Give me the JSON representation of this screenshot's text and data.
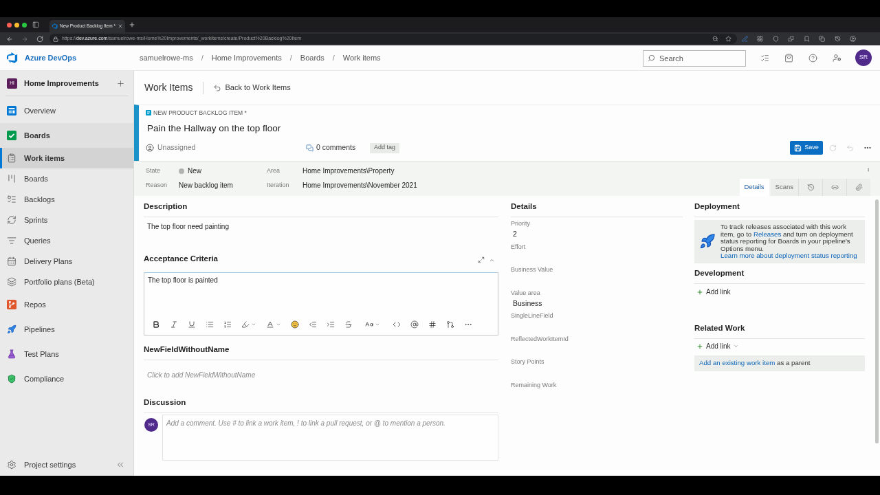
{
  "browser": {
    "tab_title": "New Product Backlog Item *",
    "url": {
      "scheme": "https://",
      "host": "dev.azure.com",
      "path": "/samuelrowe-ms/Home%20Improvements/_workitems/create/Product%20Backlog%20Item"
    }
  },
  "header": {
    "product": "Azure DevOps",
    "breadcrumb": [
      {
        "kind": "link",
        "text": "samuelrowe-ms"
      },
      {
        "kind": "separator",
        "text": "/"
      },
      {
        "kind": "link",
        "text": "Home Improvements"
      },
      {
        "kind": "separator",
        "text": "/"
      },
      {
        "kind": "link",
        "text": "Boards"
      },
      {
        "kind": "separator",
        "text": "/"
      },
      {
        "kind": "link",
        "text": "Work items"
      }
    ],
    "search": {
      "placeholder": "Search"
    },
    "avatar": "SR"
  },
  "sidebar": {
    "project": {
      "initials": "HI",
      "name": "Home Improvements"
    },
    "items": [
      {
        "label": "Overview",
        "selected": false
      },
      {
        "label": "Boards",
        "selected": false,
        "expanded": true,
        "children": [
          {
            "label": "Work items",
            "selected": true
          },
          {
            "label": "Boards",
            "selected": false
          },
          {
            "label": "Backlogs",
            "selected": false
          },
          {
            "label": "Sprints",
            "selected": false
          },
          {
            "label": "Queries",
            "selected": false
          },
          {
            "label": "Delivery Plans",
            "selected": false
          },
          {
            "label": "Portfolio plans (Beta)",
            "selected": false
          }
        ]
      },
      {
        "label": "Repos",
        "selected": false
      },
      {
        "label": "Pipelines",
        "selected": false
      },
      {
        "label": "Test Plans",
        "selected": false
      },
      {
        "label": "Compliance",
        "selected": false
      }
    ],
    "footer": "Project settings"
  },
  "page_header": {
    "title": "Work Items",
    "back": "Back to Work Items"
  },
  "work_item": {
    "type": "NEW PRODUCT BACKLOG ITEM *",
    "title": "Pain the Hallway on the top floor",
    "assignee": "Unassigned",
    "comments": "0 comments",
    "tag_button": "Add tag",
    "save": "Save",
    "fields": [
      {
        "label": "State",
        "value": "New",
        "color": "#b2b2b2"
      },
      {
        "label": "Area",
        "value": "Home Improvements\\Property"
      },
      {
        "label": "Reason",
        "value": "New backlog item"
      },
      {
        "label": "Iteration",
        "value": "Home Improvements\\November 2021"
      }
    ],
    "tabs": [
      {
        "label": "Details",
        "selected": true
      },
      {
        "label": "Scans",
        "selected": false
      },
      {
        "selected": false
      },
      {
        "selected": false
      },
      {
        "selected": false
      }
    ]
  },
  "description": {
    "heading": "Description",
    "text": "The top floor need painting"
  },
  "acceptance_criteria": {
    "heading": "Acceptance Criteria",
    "text": "The top floor is painted"
  },
  "custom_field": {
    "heading": "NewFieldWithoutName",
    "placeholder": "Click to add NewFieldWithoutName"
  },
  "discussion": {
    "heading": "Discussion",
    "avatar": "SR",
    "placeholder": "Add a comment. Use # to link a work item, ! to link a pull request, or @ to mention a person."
  },
  "details": {
    "heading": "Details",
    "fields": [
      {
        "label": "Priority",
        "value": "2"
      },
      {
        "label": "Effort"
      },
      {
        "label": "Business Value"
      },
      {
        "label": "Value area",
        "value": "Business"
      },
      {
        "label": "SingleLineField"
      },
      {
        "label": "ReflectedWorkItemId"
      },
      {
        "label": "Story Points"
      },
      {
        "label": "Remaining Work"
      }
    ]
  },
  "deployment": {
    "heading": "Deployment",
    "message": [
      {
        "kind": "text",
        "text": "To track releases associated with this work item, go to "
      },
      {
        "kind": "link",
        "text": "Releases"
      },
      {
        "kind": "text",
        "text": " and turn on deployment status reporting for Boards in your pipeline's Options menu. "
      },
      {
        "kind": "link",
        "text": "Learn more about deployment status reporting"
      }
    ]
  },
  "development": {
    "heading": "Development",
    "add_link": "Add link"
  },
  "related_work": {
    "heading": "Related Work",
    "add_link": "Add link",
    "parent_hint": [
      {
        "kind": "link",
        "text": "Add an existing work item"
      },
      {
        "kind": "text",
        "text": " as a parent"
      }
    ]
  }
}
